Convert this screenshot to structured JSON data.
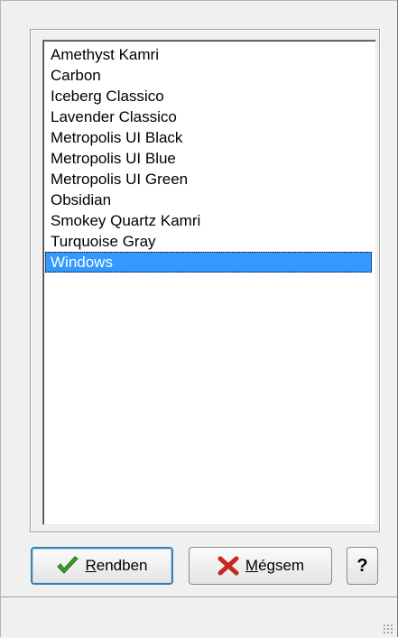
{
  "skins_list": {
    "items": [
      "Amethyst Kamri",
      "Carbon",
      "Iceberg Classico",
      "Lavender Classico",
      "Metropolis UI Black",
      "Metropolis UI Blue",
      "Metropolis UI Green",
      "Obsidian",
      "Smokey Quartz Kamri",
      "Turquoise Gray",
      "Windows"
    ],
    "selected": "Windows"
  },
  "buttons": {
    "ok_label_mnemonic": "R",
    "ok_label_rest": "endben",
    "cancel_label_mnemonic": "M",
    "cancel_label_rest": "égsem",
    "help_label": "?",
    "ok_icon": "checkmark-icon",
    "cancel_icon": "red-x-icon"
  },
  "colors": {
    "selection": "#3399ff",
    "ok_check": "#3aa02a",
    "cancel_x": "#c8281e"
  }
}
